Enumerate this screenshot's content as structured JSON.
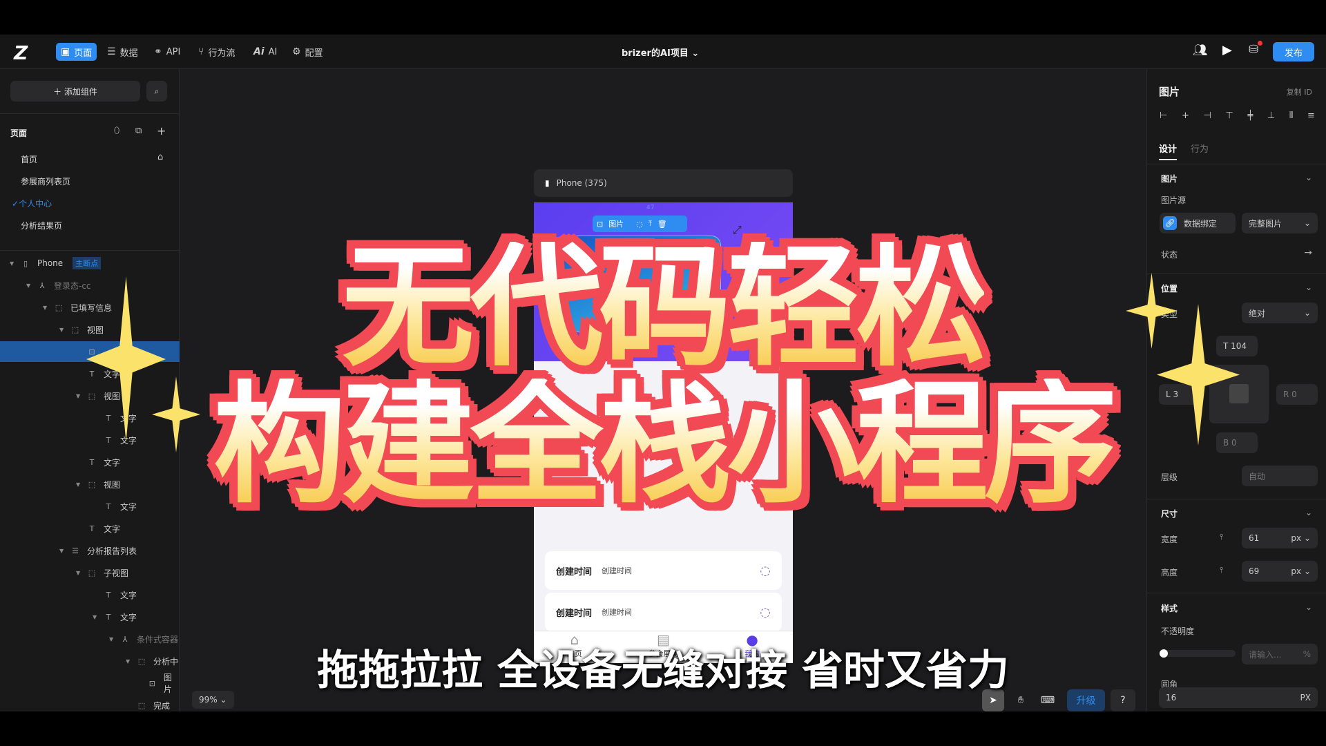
{
  "topbar": {
    "nav": [
      {
        "label": "页面",
        "icon": "page-icon",
        "active": true
      },
      {
        "label": "数据",
        "icon": "database-icon"
      },
      {
        "label": "API",
        "icon": "api-icon"
      },
      {
        "label": "行为流",
        "icon": "flow-icon"
      },
      {
        "label": "AI",
        "icon": "ai-icon"
      },
      {
        "label": "配置",
        "icon": "gear-icon"
      }
    ],
    "project": "brizer的AI项目",
    "publish": "发布"
  },
  "left": {
    "add_component": "添加组件",
    "pages_header": "页面",
    "pages": [
      "首页",
      "参展商列表页",
      "个人中心",
      "分析结果页"
    ],
    "active_page": "个人中心",
    "phone": "Phone",
    "breakpoint": "主断点",
    "tree": [
      {
        "l": 1,
        "t": "登录态-cc",
        "i": "cond"
      },
      {
        "l": 2,
        "t": "已填写信息",
        "i": "view"
      },
      {
        "l": 3,
        "t": "视图",
        "i": "view"
      },
      {
        "l": 4,
        "t": "",
        "i": "image",
        "sel": true
      },
      {
        "l": 4,
        "t": "文字",
        "i": "text"
      },
      {
        "l": 4,
        "t": "视图",
        "i": "view"
      },
      {
        "l": 5,
        "t": "文字",
        "i": "text"
      },
      {
        "l": 5,
        "t": "文字",
        "i": "text"
      },
      {
        "l": 4,
        "t": "文字",
        "i": "text"
      },
      {
        "l": 4,
        "t": "视图",
        "i": "view"
      },
      {
        "l": 5,
        "t": "文字",
        "i": "text"
      },
      {
        "l": 4,
        "t": "文字",
        "i": "text"
      },
      {
        "l": 3,
        "t": "分析报告列表",
        "i": "list"
      },
      {
        "l": 4,
        "t": "子视图",
        "i": "view"
      },
      {
        "l": 5,
        "t": "文字",
        "i": "text"
      },
      {
        "l": 5,
        "t": "文字",
        "i": "text"
      },
      {
        "l": 6,
        "t": "条件式容器",
        "i": "cond"
      },
      {
        "l": 7,
        "t": "分析中",
        "i": "view"
      },
      {
        "l": 8,
        "t": "图片",
        "i": "image"
      },
      {
        "l": 7,
        "t": "完成",
        "i": "view"
      }
    ],
    "zoom": "99%"
  },
  "canvas": {
    "device": "Phone (375)",
    "spacing": "47",
    "toolbar_label": "图片",
    "cards": [
      {
        "label": "创建时间",
        "value": "创建时间"
      },
      {
        "label": "创建时间",
        "value": "创建时间"
      }
    ],
    "tabs": [
      "主页",
      "参会展商",
      "我的"
    ]
  },
  "right": {
    "title": "图片",
    "copy_id": "复制 ID",
    "tabs": [
      "设计",
      "行为"
    ],
    "image_section": "图片",
    "image_source": "图片源",
    "data_bind": "数据绑定",
    "fit": "完整图片",
    "state": "状态",
    "position": "位置",
    "type_label": "类型",
    "type_value": "绝对",
    "top": "T 104",
    "left_v": "L 3",
    "right_v": "R 0",
    "bottom_v": "B 0",
    "layer": "层级",
    "layer_value": "自动",
    "size": "尺寸",
    "width": "宽度",
    "width_value": "61",
    "height": "高度",
    "height_value": "69",
    "unit": "px",
    "style": "样式",
    "opacity": "不透明度",
    "opacity_placeholder": "请输入...",
    "percent": "%",
    "opacity_value": 0,
    "radius": "圆角",
    "radius_value": "16",
    "radius_unit": "PX"
  },
  "bottom_tools": {
    "upgrade": "升级",
    "help": "?"
  },
  "overlay": {
    "title_line1": "无代码轻松",
    "title_line2": "构建全栈小程序",
    "subtitle": "拖拖拉拉 全设备无缝对接 省时又省力"
  },
  "colors": {
    "accent": "#2f8cf0",
    "phone_header": "#6a45f0",
    "title_outline": "#f24a55",
    "sparkle": "#fbe26a"
  }
}
